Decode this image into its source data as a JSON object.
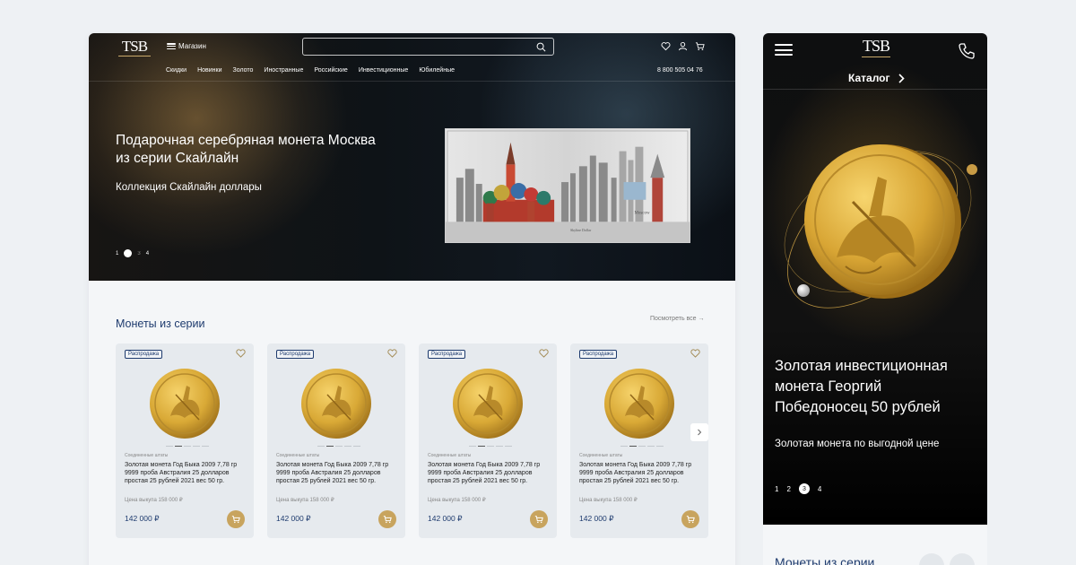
{
  "desktop": {
    "logo": "TSB",
    "menu_label": "Магазин",
    "search": {
      "value": "",
      "placeholder": ""
    },
    "nav": [
      "Скидки",
      "Новинки",
      "Золото",
      "Иностранные",
      "Российские",
      "Инвестиционные",
      "Юбилейные"
    ],
    "phone": "8 800 505 04 76",
    "hero": {
      "title": "Подарочная серебряная монета Москва из серии Скайлайн",
      "subtitle": "Коллекция Скайлайн доллары",
      "slides": [
        "1",
        "2",
        "3",
        "4"
      ],
      "active_slide": 2
    },
    "section": {
      "title": "Монеты из серии",
      "see_all": "Посмотреть все →"
    },
    "products": [
      {
        "badge": "Распродажа",
        "maker": "Соединенные штаты",
        "name": "Золотая монета Год Быка 2009 7,78 гр 9999 проба Австралия 25 долларов простая 25 рублей 2021 вес 50 гр.",
        "buyback": "Цена выкупа 158 000 ₽",
        "price": "142 000 ₽"
      },
      {
        "badge": "Распродажа",
        "maker": "Соединенные штаты",
        "name": "Золотая монета Год Быка 2009 7,78 гр 9999 проба Австралия 25 долларов простая 25 рублей 2021 вес 50 гр.",
        "buyback": "Цена выкупа 158 000 ₽",
        "price": "142 000 ₽"
      },
      {
        "badge": "Распродажа",
        "maker": "Соединенные штаты",
        "name": "Золотая монета Год Быка 2009 7,78 гр 9999 проба Австралия 25 долларов простая 25 рублей 2021 вес 50 гр.",
        "buyback": "Цена выкупа 158 000 ₽",
        "price": "142 000 ₽"
      },
      {
        "badge": "Распродажа",
        "maker": "Соединенные штаты",
        "name": "Золотая монета Год Быка 2009 7,78 гр 9999 проба Австралия 25 долларов простая 25 рублей 2021 вес 50 гр.",
        "buyback": "Цена выкупа 158 000 ₽",
        "price": "142 000 ₽"
      }
    ],
    "icons": [
      "heart-icon",
      "user-icon",
      "cart-icon",
      "search-icon",
      "chevron-right-icon"
    ]
  },
  "mobile": {
    "logo": "TSB",
    "catalog_label": "Каталог",
    "hero": {
      "title": "Золотая инвестиционная монета Георгий Победоносец 50 рублей",
      "subtitle": "Золотая монета по выгодной цене",
      "slides": [
        "1",
        "2",
        "3",
        "4"
      ],
      "active_slide": 3
    },
    "section_title": "Монеты из серии",
    "icons": [
      "menu-icon",
      "phone-icon",
      "chevron-right-icon"
    ]
  },
  "colors": {
    "accent_gold": "#c8a45e",
    "brand_blue": "#1e3b6e",
    "hero_dark": "#0e1317"
  }
}
